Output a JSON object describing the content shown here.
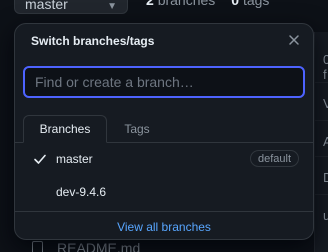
{
  "repo_header": {
    "branch_button_label": "master",
    "branches_count": "2",
    "branches_label": "branches",
    "tags_count": "0",
    "tags_label": "tags"
  },
  "background": {
    "right_fragments": [
      "0 f",
      "V",
      "A",
      "D",
      "u"
    ],
    "readme_label": "README.md"
  },
  "dropdown": {
    "title": "Switch branches/tags",
    "close_icon": "close-icon",
    "search": {
      "placeholder": "Find or create a branch…",
      "value": ""
    },
    "tabs": [
      {
        "label": "Branches",
        "active": true
      },
      {
        "label": "Tags",
        "active": false
      }
    ],
    "branches": [
      {
        "name": "master",
        "selected": true,
        "badge": "default"
      },
      {
        "name": "dev-9.4.6",
        "selected": false,
        "badge": ""
      }
    ],
    "footer_link": "View all branches"
  },
  "colors": {
    "background": "#0d1117",
    "panel": "#161b22",
    "border": "#30363d",
    "focus": "#4d63ff",
    "link": "#58a6ff",
    "muted": "#8b949e"
  }
}
